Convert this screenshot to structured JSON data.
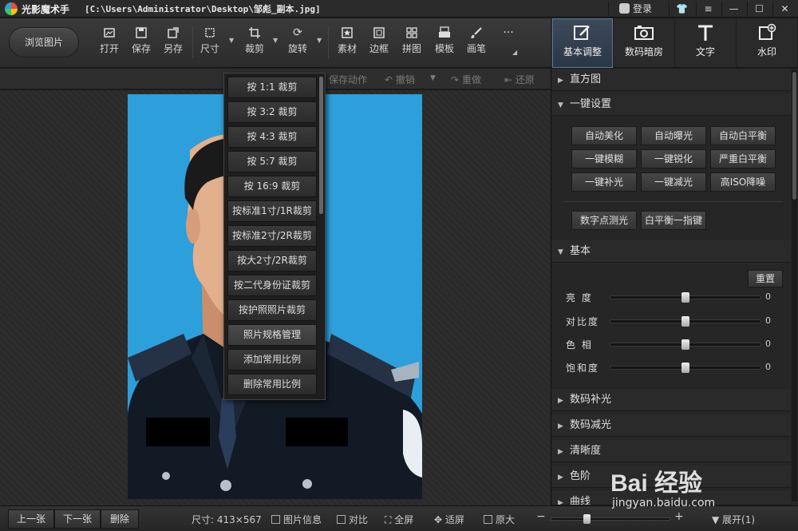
{
  "titlebar": {
    "app_name": "光影魔术手",
    "file_path": "[C:\\Users\\Administrator\\Desktop\\邹彪_副本.jpg]",
    "login": "登录"
  },
  "toolbar": {
    "browse": "浏览图片",
    "tools": [
      {
        "label": "打开",
        "icon": "open-icon"
      },
      {
        "label": "保存",
        "icon": "save-icon"
      },
      {
        "label": "另存",
        "icon": "save-as-icon"
      },
      {
        "label": "尺寸",
        "icon": "resize-icon"
      },
      {
        "label": "裁剪",
        "icon": "crop-icon"
      },
      {
        "label": "旋转",
        "icon": "rotate-icon"
      },
      {
        "label": "素材",
        "icon": "material-icon"
      },
      {
        "label": "边框",
        "icon": "border-icon"
      },
      {
        "label": "拼图",
        "icon": "collage-icon"
      },
      {
        "label": "模板",
        "icon": "template-icon"
      },
      {
        "label": "画笔",
        "icon": "brush-icon"
      }
    ],
    "more": "···"
  },
  "right_tabs": [
    {
      "label": "基本调整",
      "icon": "adjust-icon",
      "active": true
    },
    {
      "label": "数码暗房",
      "icon": "camera-icon",
      "active": false
    },
    {
      "label": "文字",
      "icon": "text-icon",
      "active": false
    },
    {
      "label": "水印",
      "icon": "watermark-icon",
      "active": false
    }
  ],
  "subbar": {
    "save_action": "保存动作",
    "undo": "撤销",
    "redo": "重做",
    "restore": "还原"
  },
  "crop_menu": [
    "按 1:1 裁剪",
    "按 3:2 裁剪",
    "按 4:3 裁剪",
    "按 5:7 裁剪",
    "按 16:9 裁剪",
    "按标准1寸/1R裁剪",
    "按标准2寸/2R裁剪",
    "按大2寸/2R裁剪",
    "按二代身份证裁剪",
    "按护照照片裁剪",
    "照片规格管理",
    "添加常用比例",
    "删除常用比例"
  ],
  "panel": {
    "histogram": "直方图",
    "one_click": "一键设置",
    "one_click_buttons": [
      "自动美化",
      "自动曝光",
      "自动白平衡",
      "一键模糊",
      "一键锐化",
      "严重白平衡",
      "一键补光",
      "一键减光",
      "高ISO降噪"
    ],
    "extra_buttons": [
      "数字点测光",
      "白平衡一指键"
    ],
    "basic": "基本",
    "reset": "重置",
    "sliders": [
      {
        "label": "亮  度",
        "value": "0",
        "position": 0.5
      },
      {
        "label": "对比度",
        "value": "0",
        "position": 0.5
      },
      {
        "label": "色  相",
        "value": "0",
        "position": 0.5
      },
      {
        "label": "饱和度",
        "value": "0",
        "position": 0.5
      }
    ],
    "sections": [
      "数码补光",
      "数码减光",
      "清晰度",
      "色阶",
      "曲线"
    ]
  },
  "statusbar": {
    "prev": "上一张",
    "next": "下一张",
    "delete": "删除",
    "size": "尺寸: 413×567",
    "info": "图片信息",
    "compare": "对比",
    "fullscreen": "全屏",
    "fit": "适屏",
    "original": "原大",
    "expand": "展开(1)"
  },
  "watermark": {
    "main": "Bai 经验",
    "url": "jingyan.baidu.com"
  }
}
